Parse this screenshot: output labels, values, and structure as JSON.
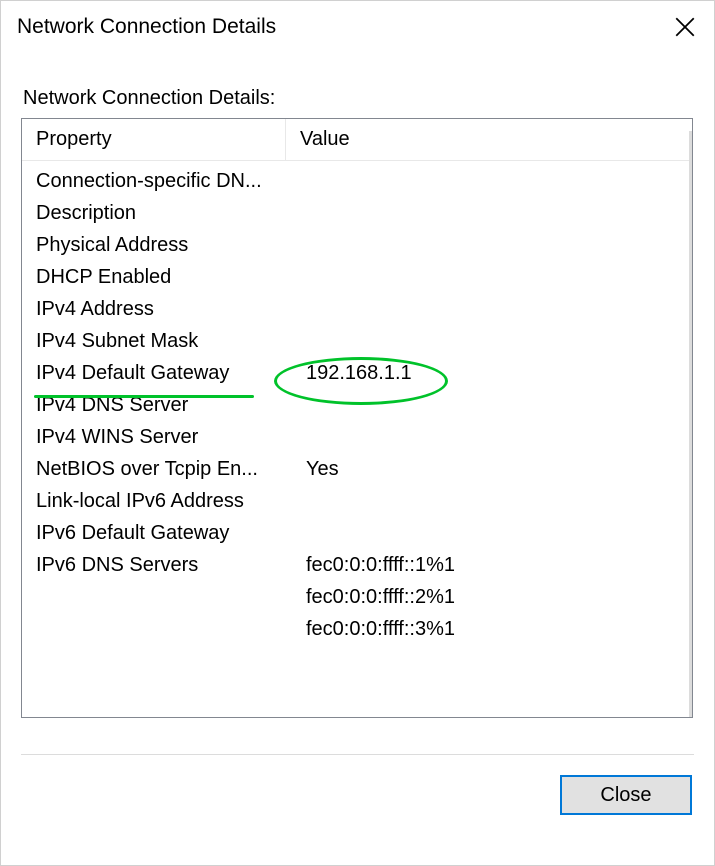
{
  "window": {
    "title": "Network Connection Details"
  },
  "details": {
    "label": "Network Connection Details:",
    "columns": {
      "property": "Property",
      "value": "Value"
    },
    "rows": [
      {
        "property": "Connection-specific DN...",
        "value": ""
      },
      {
        "property": "Description",
        "value": ""
      },
      {
        "property": "Physical Address",
        "value": ""
      },
      {
        "property": "DHCP Enabled",
        "value": ""
      },
      {
        "property": "IPv4 Address",
        "value": ""
      },
      {
        "property": "IPv4 Subnet Mask",
        "value": ""
      },
      {
        "property": "IPv4 Default Gateway",
        "value": "192.168.1.1"
      },
      {
        "property": "IPv4 DNS Server",
        "value": ""
      },
      {
        "property": "IPv4 WINS Server",
        "value": ""
      },
      {
        "property": "NetBIOS over Tcpip En...",
        "value": "Yes"
      },
      {
        "property": "Link-local IPv6 Address",
        "value": ""
      },
      {
        "property": "IPv6 Default Gateway",
        "value": ""
      },
      {
        "property": "IPv6 DNS Servers",
        "value": "fec0:0:0:ffff::1%1"
      },
      {
        "property": "",
        "value": "fec0:0:0:ffff::2%1"
      },
      {
        "property": "",
        "value": "fec0:0:0:ffff::3%1"
      }
    ]
  },
  "buttons": {
    "close": "Close"
  },
  "annotation": {
    "highlighted_property": "IPv4 Default Gateway",
    "highlighted_value": "192.168.1.1",
    "color": "#00c22a"
  }
}
